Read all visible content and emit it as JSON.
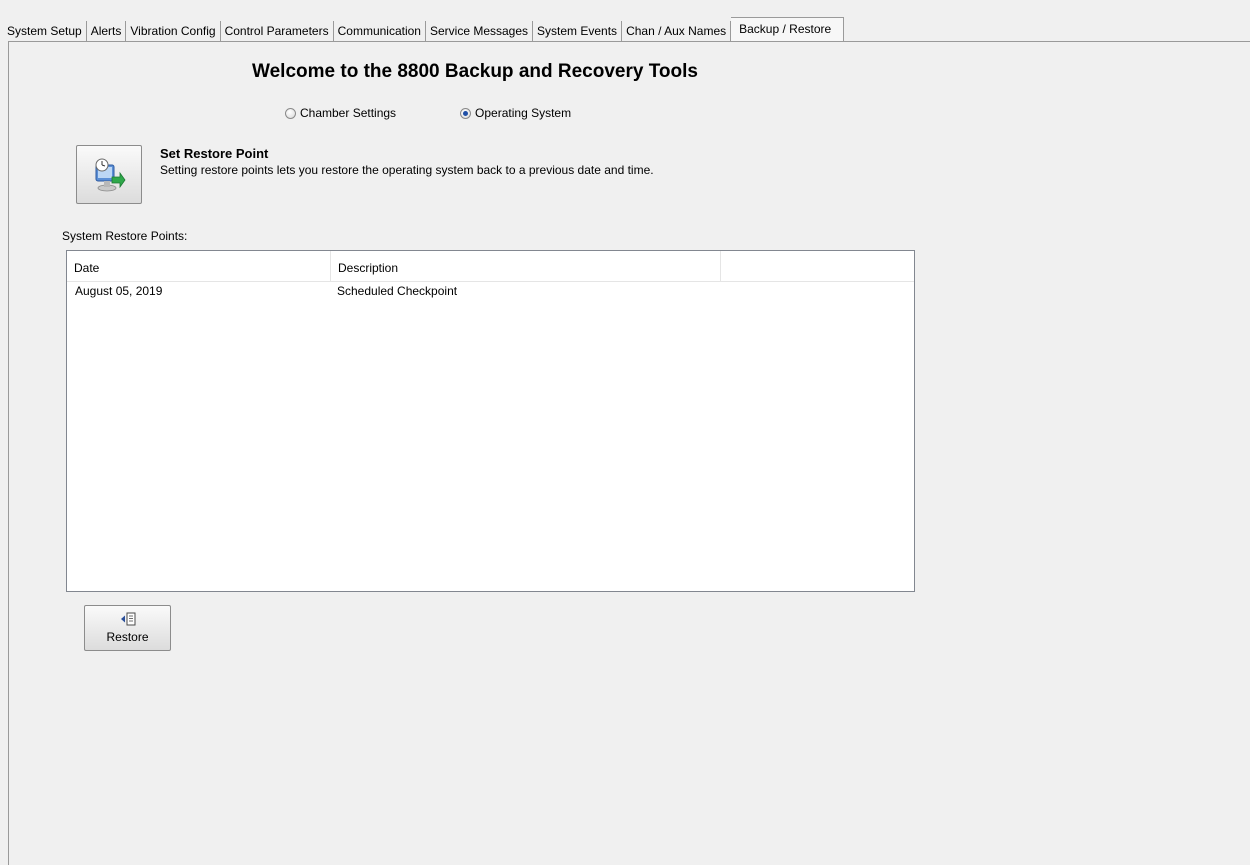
{
  "tabs": [
    {
      "label": "System Setup"
    },
    {
      "label": "Alerts"
    },
    {
      "label": "Vibration Config"
    },
    {
      "label": "Control Parameters"
    },
    {
      "label": "Communication"
    },
    {
      "label": "Service Messages"
    },
    {
      "label": "System Events"
    },
    {
      "label": "Chan / Aux Names"
    },
    {
      "label": "Backup / Restore",
      "active": true
    }
  ],
  "page": {
    "title": "Welcome to the 8800 Backup and Recovery Tools"
  },
  "mode": {
    "options": [
      {
        "label": "Chamber Settings",
        "checked": false
      },
      {
        "label": "Operating System",
        "checked": true
      }
    ]
  },
  "restore_point": {
    "heading": "Set Restore Point",
    "description": "Setting restore points lets you restore the operating system back to a previous date and time.",
    "icon": "system-restore-icon"
  },
  "restore_points_list": {
    "label": "System Restore Points:",
    "columns": [
      "Date",
      "Description",
      ""
    ],
    "rows": [
      {
        "date": "August 05, 2019",
        "description": "Scheduled Checkpoint"
      }
    ]
  },
  "restore_button": {
    "label": "Restore",
    "icon": "restore-document-icon"
  },
  "colors": {
    "background": "#f0f0f0",
    "radio_checked": "#1f4fa6",
    "list_border": "#828790"
  }
}
